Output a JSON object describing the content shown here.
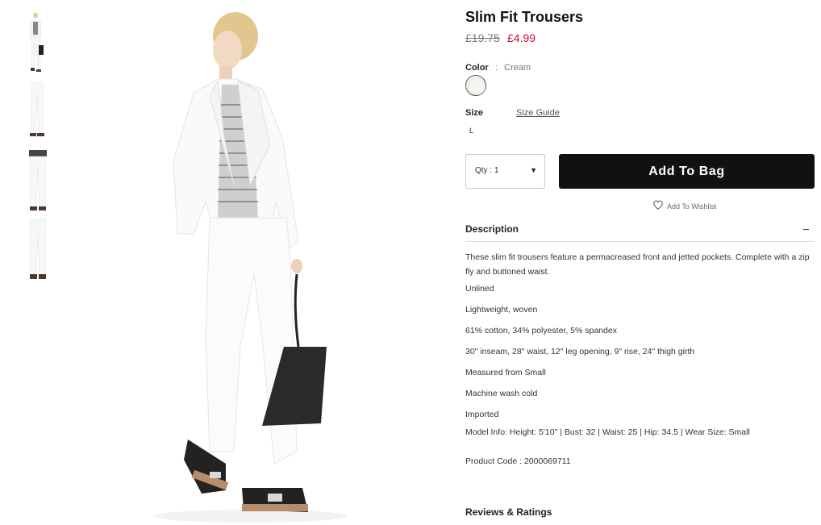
{
  "product": {
    "title": "Slim Fit Trousers",
    "price_original": "£19.75",
    "price_sale": "£4.99"
  },
  "color": {
    "label": "Color",
    "separator": ":",
    "value": "Cream",
    "swatch_color": "#f7f5f0"
  },
  "size": {
    "label": "Size",
    "guide_link": "Size Guide",
    "options": [
      "L"
    ]
  },
  "purchase": {
    "qty_label": "Qty : 1",
    "qty_arrow": "▼",
    "add_to_bag": "Add To Bag",
    "wishlist": "Add To Wishlist"
  },
  "description": {
    "heading": "Description",
    "toggle": "–",
    "paragraph": "These slim fit trousers feature a permacreased front and jetted pockets. Complete with a zip fly and buttoned waist.",
    "features": [
      "Unlined",
      "Lightweight, woven",
      "61% cotton, 34% polyester, 5% spandex",
      "30\" inseam, 28\" waist, 12\" leg opening, 9\" rise, 24\" thigh girth",
      "Measured from Small",
      "Machine wash cold",
      "Imported"
    ],
    "model_info": "Model Info: Height: 5'10\" | Bust: 32 | Waist: 25 | Hip: 34.5 | Wear Size: Small",
    "product_code": "Product Code : 2000069711"
  },
  "reviews": {
    "heading": "Reviews & Ratings"
  },
  "colors": {
    "accent_sale": "#c8102e",
    "button_bg": "#111111"
  }
}
